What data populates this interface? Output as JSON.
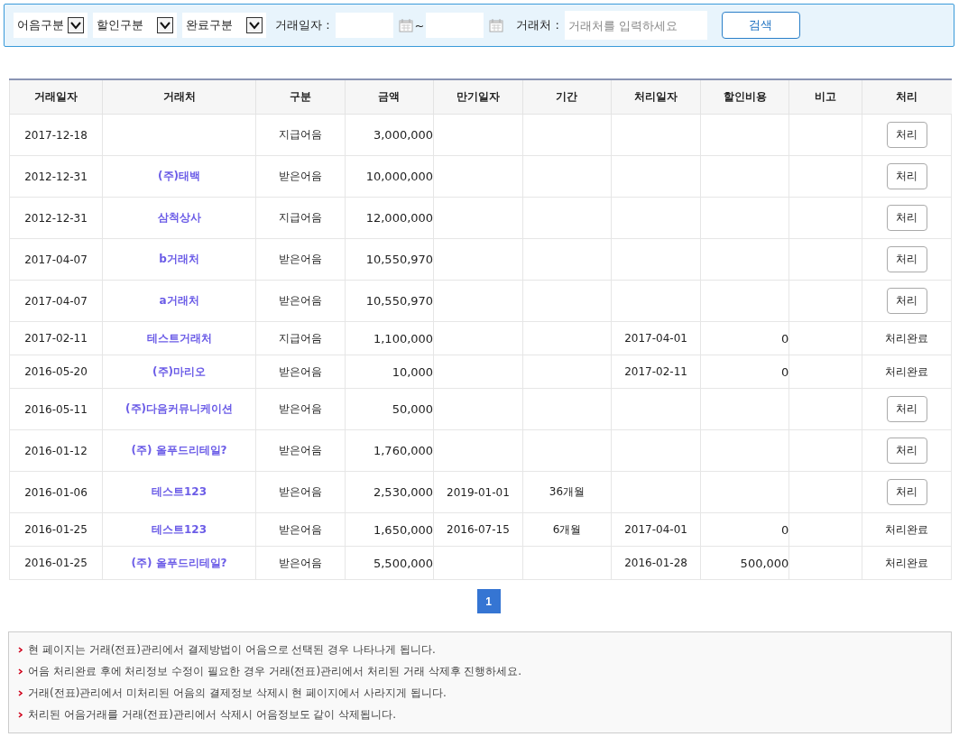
{
  "filter_bar": {
    "selects": [
      {
        "label": "어음구분"
      },
      {
        "label": "할인구분"
      },
      {
        "label": "완료구분"
      }
    ],
    "date_label": "거래일자 :",
    "date_separator": "~",
    "partner_label": "거래처 :",
    "partner_field": {
      "placeholder": "거래처를 입력하세요"
    },
    "search_button": "검색"
  },
  "table": {
    "columns": [
      "거래일자",
      "거래처",
      "구분",
      "금액",
      "만기일자",
      "기간",
      "처리일자",
      "할인비용",
      "비고",
      "처리"
    ],
    "rows": [
      {
        "date": "2017-12-18",
        "partner": "",
        "type": "지급어음",
        "amount": "3,000,000",
        "due": "",
        "period": "",
        "processed": "",
        "discount": "",
        "action": {
          "kind": "button",
          "text": "처리"
        }
      },
      {
        "date": "2012-12-31",
        "partner": "(주)태백",
        "type": "받은어음",
        "amount": "10,000,000",
        "due": "",
        "period": "",
        "processed": "",
        "discount": "",
        "action": {
          "kind": "button",
          "text": "처리"
        }
      },
      {
        "date": "2012-12-31",
        "partner": "삼척상사",
        "type": "지급어음",
        "amount": "12,000,000",
        "due": "",
        "period": "",
        "processed": "",
        "discount": "",
        "action": {
          "kind": "button",
          "text": "처리"
        }
      },
      {
        "date": "2017-04-07",
        "partner": "b거래처",
        "type": "받은어음",
        "amount": "10,550,970",
        "due": "",
        "period": "",
        "processed": "",
        "discount": "",
        "action": {
          "kind": "button",
          "text": "처리"
        }
      },
      {
        "date": "2017-04-07",
        "partner": "a거래처",
        "type": "받은어음",
        "amount": "10,550,970",
        "due": "",
        "period": "",
        "processed": "",
        "discount": "",
        "action": {
          "kind": "button",
          "text": "처리"
        }
      },
      {
        "date": "2017-02-11",
        "partner": "테스트거래처",
        "type": "지급어음",
        "amount": "1,100,000",
        "due": "",
        "period": "",
        "processed": "2017-04-01",
        "discount": "0",
        "action": {
          "kind": "done",
          "text": "처리완료"
        }
      },
      {
        "date": "2016-05-20",
        "partner": "(주)마리오",
        "type": "받은어음",
        "amount": "10,000",
        "due": "",
        "period": "",
        "processed": "2017-02-11",
        "discount": "0",
        "action": {
          "kind": "done",
          "text": "처리완료"
        }
      },
      {
        "date": "2016-05-11",
        "partner": "(주)다음커뮤니케이션",
        "type": "받은어음",
        "amount": "50,000",
        "due": "",
        "period": "",
        "processed": "",
        "discount": "",
        "action": {
          "kind": "button",
          "text": "처리"
        }
      },
      {
        "date": "2016-01-12",
        "partner": "(주) 올푸드리테일?",
        "type": "받은어음",
        "amount": "1,760,000",
        "due": "",
        "period": "",
        "processed": "",
        "discount": "",
        "action": {
          "kind": "button",
          "text": "처리"
        }
      },
      {
        "date": "2016-01-06",
        "partner": "테스트123",
        "type": "받은어음",
        "amount": "2,530,000",
        "due": "2019-01-01",
        "period": "36개월",
        "processed": "",
        "discount": "",
        "action": {
          "kind": "button",
          "text": "처리"
        }
      },
      {
        "date": "2016-01-25",
        "partner": "테스트123",
        "type": "받은어음",
        "amount": "1,650,000",
        "due": "2016-07-15",
        "period": "6개월",
        "processed": "2017-04-01",
        "discount": "0",
        "action": {
          "kind": "done",
          "text": "처리완료"
        }
      },
      {
        "date": "2016-01-25",
        "partner": "(주) 올푸드리테일?",
        "type": "받은어음",
        "amount": "5,500,000",
        "due": "",
        "period": "",
        "processed": "2016-01-28",
        "discount": "500,000",
        "action": {
          "kind": "done",
          "text": "처리완료"
        }
      }
    ]
  },
  "pagination": [
    {
      "label": "1",
      "selected": true
    }
  ],
  "notes": [
    "현 페이지는 거래(전표)관리에서 결제방법이 어음으로 선택된 경우 나타나게 됩니다.",
    "어음 처리완료 후에 처리정보 수정이 필요한 경우 거래(전표)관리에서 처리된 거래 삭제후 진행하세요.",
    "거래(전표)관리에서 미처리된 어음의 결제정보 삭제시 현 페이지에서 사라지게 됩니다.",
    "처리된 어음거래를 거래(전표)관리에서 삭제시 어음정보도 같이 삭제됩니다."
  ]
}
